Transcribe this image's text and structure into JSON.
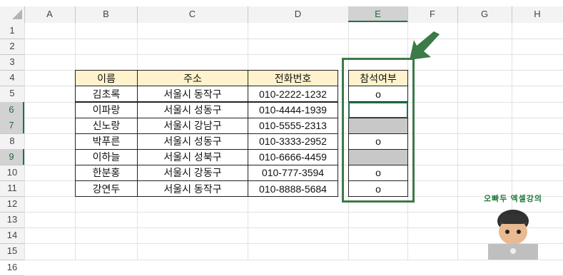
{
  "columns": [
    "A",
    "B",
    "C",
    "D",
    "E",
    "F",
    "G",
    "H"
  ],
  "rows": [
    "1",
    "2",
    "3",
    "4",
    "5",
    "6",
    "7",
    "8",
    "9",
    "10",
    "11",
    "12",
    "13",
    "14",
    "15",
    "16"
  ],
  "selected_column": "E",
  "selected_rows": [
    "6",
    "7",
    "9"
  ],
  "table": {
    "headers": [
      "이름",
      "주소",
      "전화번호"
    ],
    "rows": [
      [
        "김초록",
        "서울시 동작구",
        "010-2222-1232"
      ],
      [
        "이파랑",
        "서울시 성동구",
        "010-4444-1939"
      ],
      [
        "신노랑",
        "서울시 강남구",
        "010-5555-2313"
      ],
      [
        "박푸른",
        "서울시 성동구",
        "010-3333-2952"
      ],
      [
        "이하늘",
        "서울시 성북구",
        "010-6666-4459"
      ],
      [
        "한분홍",
        "서울시 강동구",
        "010-777-3594"
      ],
      [
        "강연두",
        "서울시 동작구",
        "010-8888-5684"
      ]
    ]
  },
  "attendance": {
    "header": "참석여부",
    "values": [
      "o",
      "",
      "",
      "o",
      "",
      "o",
      "o"
    ]
  },
  "mascot_text": "오빠두 엑셀강의",
  "colors": {
    "header_fill": "#fff2cc",
    "blank_fill": "#c8c8c8",
    "highlight": "#3c7a48",
    "selection": "#217346"
  }
}
